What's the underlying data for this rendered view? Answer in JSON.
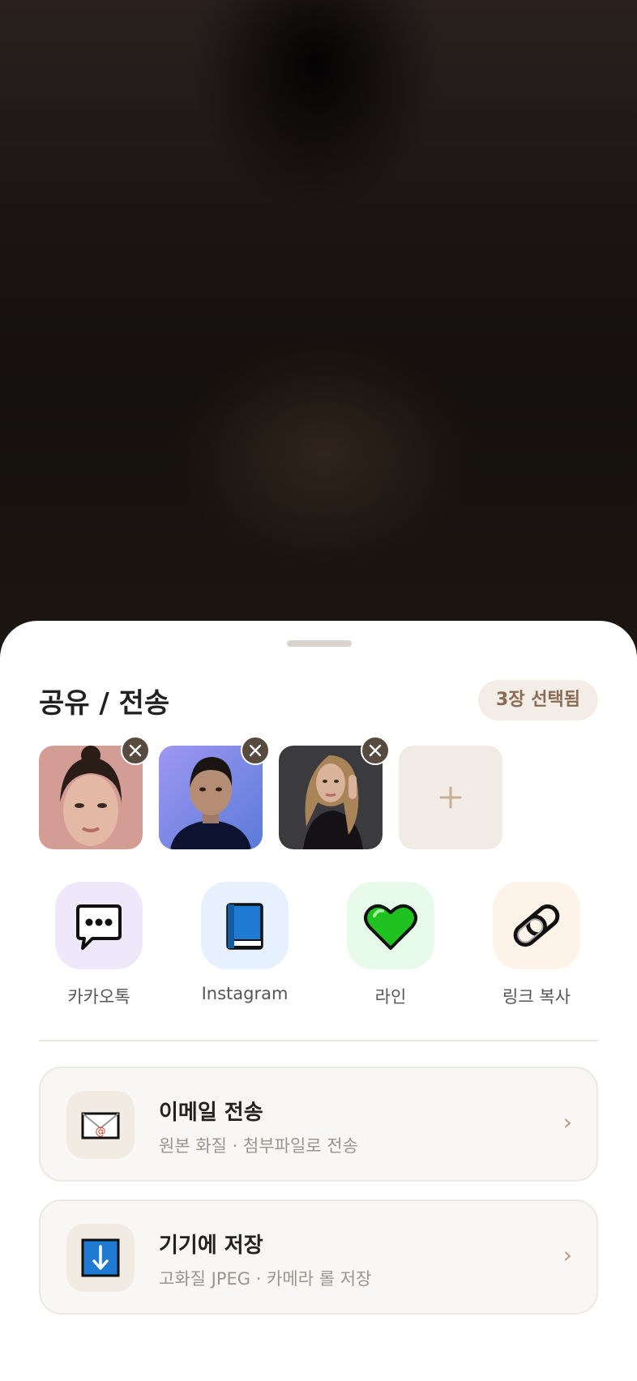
{
  "share_sheet": {
    "title": "공유 / 전송",
    "selected_count": "3장 선택됨"
  },
  "selected_photos": [
    {
      "icon": "photo-thumbnail-1"
    },
    {
      "icon": "photo-thumbnail-2"
    },
    {
      "icon": "photo-thumbnail-3"
    }
  ],
  "add_photo": {
    "icon": "plus-icon"
  },
  "share_targets": [
    {
      "label": "카카오톡",
      "icon": "chat-bubble-icon",
      "bg": "#efe8fb"
    },
    {
      "label": "Instagram",
      "icon": "book-icon",
      "bg": "#e7f1fd"
    },
    {
      "label": "라인",
      "icon": "heart-icon",
      "bg": "#e8fbeb"
    },
    {
      "label": "링크 복사",
      "icon": "link-icon",
      "bg": "#fdf3e8"
    }
  ],
  "actions": [
    {
      "title": "이메일 전송",
      "subtitle": "원본 화질 · 첨부파일로 전송",
      "icon": "envelope-icon"
    },
    {
      "title": "기기에 저장",
      "subtitle": "고화질 JPEG · 카메라 롤 저장",
      "icon": "download-arrow-icon"
    }
  ],
  "chevron": "›",
  "colors": {
    "accent": "#8a6a50",
    "remove_button": "#574a3f"
  }
}
